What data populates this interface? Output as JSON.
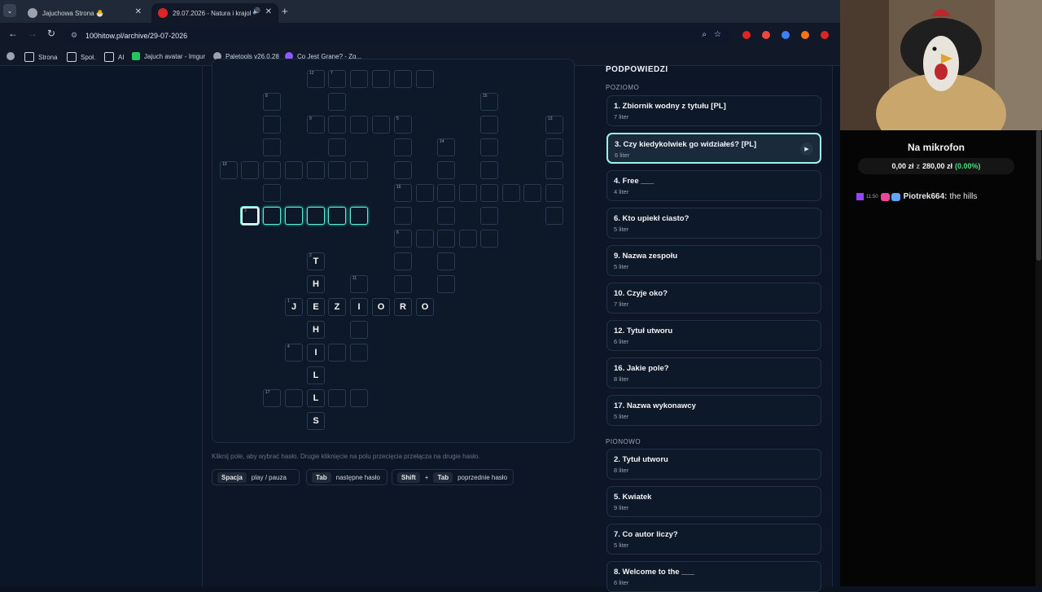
{
  "browser": {
    "tabs": [
      {
        "title": "Jajuchowa Strona 🐣",
        "close": "✕"
      },
      {
        "title": "29.07.2026 - Natura i krajol",
        "close": "✕"
      }
    ],
    "new_tab": "+",
    "url": "100hitow.pl/archive/29-07-2026",
    "bookmarks": [
      "Strona",
      "Społ.",
      "AI",
      "Jajuch avatar - Imgur",
      "Paletools v26.0.28",
      "Co Jest Grane? - Zg..."
    ]
  },
  "crossword": {
    "cells": [
      {
        "r": "",
        "n": "12"
      },
      {
        "r": "",
        "n": "7"
      },
      {
        "r": "",
        "n": ""
      },
      {
        "r": "",
        "n": ""
      },
      {
        "r": "",
        "n": ""
      },
      {
        "r": "",
        "n": ""
      },
      {
        "r": "",
        "n": "8"
      },
      {
        "r": "",
        "n": ""
      },
      {
        "r": "",
        "n": "15"
      },
      {
        "r": "",
        "n": ""
      },
      {
        "r": "",
        "n": "9"
      },
      {
        "r": "",
        "n": ""
      },
      {
        "r": "",
        "n": ""
      },
      {
        "r": "",
        "n": ""
      },
      {
        "r": "",
        "n": "5"
      },
      {
        "r": "",
        "n": ""
      },
      {
        "r": "",
        "n": "13"
      },
      {
        "r": "",
        "n": ""
      },
      {
        "r": "",
        "n": ""
      },
      {
        "r": "",
        "n": ""
      },
      {
        "r": "",
        "n": "14"
      },
      {
        "r": "",
        "n": ""
      },
      {
        "r": "",
        "n": ""
      },
      {
        "r": "",
        "n": "10"
      },
      {
        "r": "",
        "n": ""
      },
      {
        "r": "",
        "n": ""
      },
      {
        "r": "",
        "n": ""
      },
      {
        "r": "",
        "n": ""
      },
      {
        "r": "",
        "n": ""
      },
      {
        "r": "",
        "n": ""
      },
      {
        "r": "",
        "n": ""
      },
      {
        "r": "",
        "n": ""
      },
      {
        "r": "",
        "n": ""
      },
      {
        "r": "",
        "n": ""
      },
      {
        "r": "",
        "n": ""
      },
      {
        "r": "",
        "n": "16"
      },
      {
        "r": "",
        "n": ""
      },
      {
        "r": "",
        "n": ""
      },
      {
        "r": "",
        "n": ""
      },
      {
        "r": "",
        "n": ""
      },
      {
        "r": "",
        "n": ""
      },
      {
        "r": "",
        "n": ""
      },
      {
        "r": "",
        "n": ""
      },
      {
        "r": "",
        "n": "3"
      },
      {
        "r": "",
        "n": ""
      },
      {
        "r": "",
        "n": ""
      },
      {
        "r": "",
        "n": ""
      },
      {
        "r": "",
        "n": ""
      },
      {
        "r": "",
        "n": ""
      },
      {
        "r": "",
        "n": ""
      },
      {
        "r": "",
        "n": ""
      },
      {
        "r": "",
        "n": ""
      },
      {
        "r": "",
        "n": ""
      },
      {
        "r": "",
        "n": "6"
      },
      {
        "r": "",
        "n": ""
      },
      {
        "r": "",
        "n": ""
      },
      {
        "r": "",
        "n": ""
      },
      {
        "r": "",
        "n": ""
      },
      {
        "r": "T",
        "n": "2"
      },
      {
        "r": "",
        "n": ""
      },
      {
        "r": "",
        "n": ""
      },
      {
        "r": "H",
        "n": ""
      },
      {
        "r": "",
        "n": "11"
      },
      {
        "r": "",
        "n": ""
      },
      {
        "r": "",
        "n": ""
      },
      {
        "r": "J",
        "n": "1"
      },
      {
        "r": "E",
        "n": ""
      },
      {
        "r": "Z",
        "n": ""
      },
      {
        "r": "I",
        "n": ""
      },
      {
        "r": "O",
        "n": ""
      },
      {
        "r": "R",
        "n": ""
      },
      {
        "r": "O",
        "n": ""
      },
      {
        "r": "H",
        "n": ""
      },
      {
        "r": "",
        "n": ""
      },
      {
        "r": "",
        "n": "4"
      },
      {
        "r": "I",
        "n": ""
      },
      {
        "r": "",
        "n": ""
      },
      {
        "r": "",
        "n": ""
      },
      {
        "r": "L",
        "n": ""
      },
      {
        "r": "",
        "n": "17"
      },
      {
        "r": "",
        "n": ""
      },
      {
        "r": "L",
        "n": ""
      },
      {
        "r": "",
        "n": ""
      },
      {
        "r": "",
        "n": ""
      },
      {
        "r": "S",
        "n": ""
      }
    ]
  },
  "help": {
    "text": "Kliknij pole, aby wybrać hasło. Drugie kliknięcie na polu przecięcia przełącza na drugie hasło.",
    "keys": [
      {
        "k1": "Spacja",
        "k2": "",
        "plus": "",
        "label": "play / pauza"
      },
      {
        "k1": "Tab",
        "k2": "",
        "plus": "",
        "label": "następne hasło"
      },
      {
        "k1": "Shift",
        "k2": "Tab",
        "plus": "+",
        "label": "poprzednie hasło"
      }
    ]
  },
  "hints": {
    "title": "PODPOWIEDZI",
    "across_label": "POZIOMO",
    "down_label": "PIONOWO",
    "across": [
      {
        "title": "1. Zbiornik wodny z tytułu [PL]",
        "sub": "7 liter"
      },
      {
        "title": "3. Czy kiedykolwiek go widziałeś? [PL]",
        "sub": "6 liter"
      },
      {
        "title": "4. Free ___",
        "sub": "4 liter"
      },
      {
        "title": "6. Kto upiekł ciasto?",
        "sub": "5 liter"
      },
      {
        "title": "9. Nazwa zespołu",
        "sub": "5 liter"
      },
      {
        "title": "10. Czyje oko?",
        "sub": "7 liter"
      },
      {
        "title": "12. Tytuł utworu",
        "sub": "6 liter"
      },
      {
        "title": "16. Jakie pole?",
        "sub": "8 liter"
      },
      {
        "title": "17. Nazwa wykonawcy",
        "sub": "5 liter"
      }
    ],
    "down": [
      {
        "title": "2. Tytuł utworu",
        "sub": "8 liter"
      },
      {
        "title": "5. Kwiatek",
        "sub": "9 liter"
      },
      {
        "title": "7. Co autor liczy?",
        "sub": "5 liter"
      },
      {
        "title": "8. Welcome to the ___",
        "sub": "6 liter"
      }
    ],
    "play_icon": "▶"
  },
  "stream": {
    "title": "Na mikrofon",
    "goal_current": "0,00 zł",
    "goal_sep": "z",
    "goal_target": "280,00 zł",
    "goal_pct": "(0.00%)",
    "chat_time": "11:50",
    "chat_user": "Piotrek664:",
    "chat_msg": "the hills"
  },
  "colors": {
    "accent": "#5eead4",
    "bg": "#0a1424",
    "pct": "#4ade80"
  }
}
